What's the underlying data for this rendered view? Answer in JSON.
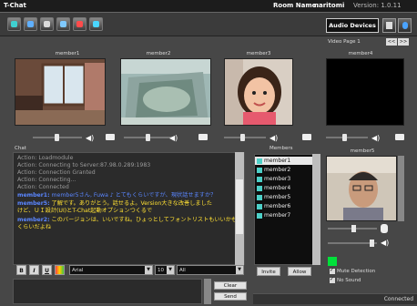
{
  "app": {
    "title": "T-Chat",
    "room_label": "Room Name:",
    "room_name": "naritomi",
    "version": "Version: 1.0.11"
  },
  "toolbar": {
    "audio_devices_label": "Audio Devices"
  },
  "video": {
    "page_label": "Video Page 1",
    "page_nav": [
      "<<",
      ">>"
    ],
    "panels": [
      {
        "label": "member1"
      },
      {
        "label": "member2"
      },
      {
        "label": "member3"
      },
      {
        "label": "member4"
      }
    ]
  },
  "chat": {
    "label": "Chat",
    "lines": [
      {
        "text": "Action: Loadmodule",
        "style": "gray"
      },
      {
        "text": "Action: Connecting to Server:87.98.0.289:1983",
        "style": "gray"
      },
      {
        "text": "Action: Connection Granted",
        "style": "gray"
      },
      {
        "text": "Action: Connecting...",
        "style": "gray"
      },
      {
        "text": "Action: Connected",
        "style": "gray"
      },
      {
        "speaker": "member1:",
        "text": " member5さん, Fuwa ♪ とてもくらいですが、現状話せますか？",
        "style": "blue"
      },
      {
        "speaker": "member5:",
        "text": " 了解です。ありがとう。話せるよ。Version大きな改善しました",
        "style": "yellow"
      },
      {
        "speaker": "",
        "text": "けど、ＵＩ設計(UI)とT-Chat起動オプションつくるで",
        "style": "yellow"
      },
      {
        "speaker": "member2:",
        "text": " このバージョンは、いいですね。ひょっとしてフォントリストもいいかも",
        "style": "yellow"
      },
      {
        "speaker": "",
        "text": "くらいだよね",
        "style": "yellow"
      }
    ]
  },
  "format": {
    "bold": "B",
    "italic": "I",
    "underline": "U",
    "font": "Arial",
    "size": "10",
    "target": "All"
  },
  "input": {
    "clear_label": "Clear",
    "send_label": "Send"
  },
  "members": {
    "label": "Members",
    "list": [
      "member1",
      "member2",
      "member3",
      "member4",
      "member5",
      "member6",
      "member7"
    ],
    "invite_label": "Invite",
    "allow_label": "Allow"
  },
  "self": {
    "label": "member5"
  },
  "options": {
    "mute_detection": "Mute Detection",
    "no_sound": "No Sound"
  },
  "status": {
    "text": "Connected"
  },
  "colors": {
    "accent_blue": "#5a86ff",
    "chat_yellow": "#ffe033",
    "mic_level": "#00e03a"
  }
}
